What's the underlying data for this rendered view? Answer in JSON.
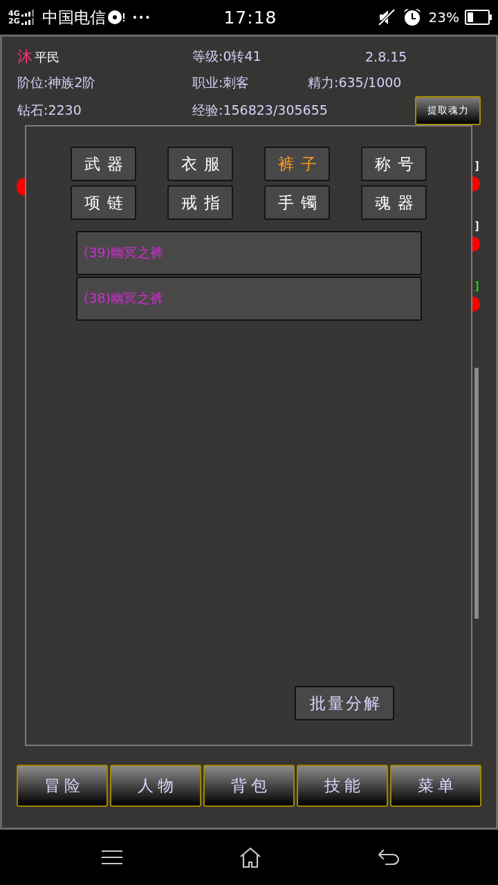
{
  "status_bar": {
    "network_top": "4G",
    "network_bottom": "2G",
    "carrier": "中国电信",
    "notifications_more": "•••",
    "time": "17:18",
    "battery": "23%"
  },
  "player": {
    "name": "沐",
    "title": "平民",
    "level": "等级:0转41",
    "version": "2.8.15",
    "tier": "阶位:神族2阶",
    "class": "职业:刺客",
    "energy": "精力:635/1000",
    "diamonds": "钻石:2230",
    "experience": "经验:156823/305655",
    "extract_button": "提取魂力"
  },
  "background_marks": [
    {
      "text": "]",
      "color": "#ffffff"
    },
    {
      "text": "]",
      "color": "#ffffff"
    },
    {
      "text": "]",
      "color": "#00ee00"
    }
  ],
  "dialog": {
    "categories": [
      {
        "label": "武器",
        "selected": false
      },
      {
        "label": "衣服",
        "selected": false
      },
      {
        "label": "裤子",
        "selected": true
      },
      {
        "label": "称号",
        "selected": false
      },
      {
        "label": "项链",
        "selected": false
      },
      {
        "label": "戒指",
        "selected": false
      },
      {
        "label": "手镯",
        "selected": false
      },
      {
        "label": "魂器",
        "selected": false
      }
    ],
    "items": [
      {
        "label": "(39)幽冥之裤"
      },
      {
        "label": "(38)幽冥之裤"
      }
    ],
    "action_button": "批量分解"
  },
  "bottom_tabs": [
    {
      "label": "冒险"
    },
    {
      "label": "人物"
    },
    {
      "label": "背包"
    },
    {
      "label": "技能"
    },
    {
      "label": "菜单"
    }
  ]
}
